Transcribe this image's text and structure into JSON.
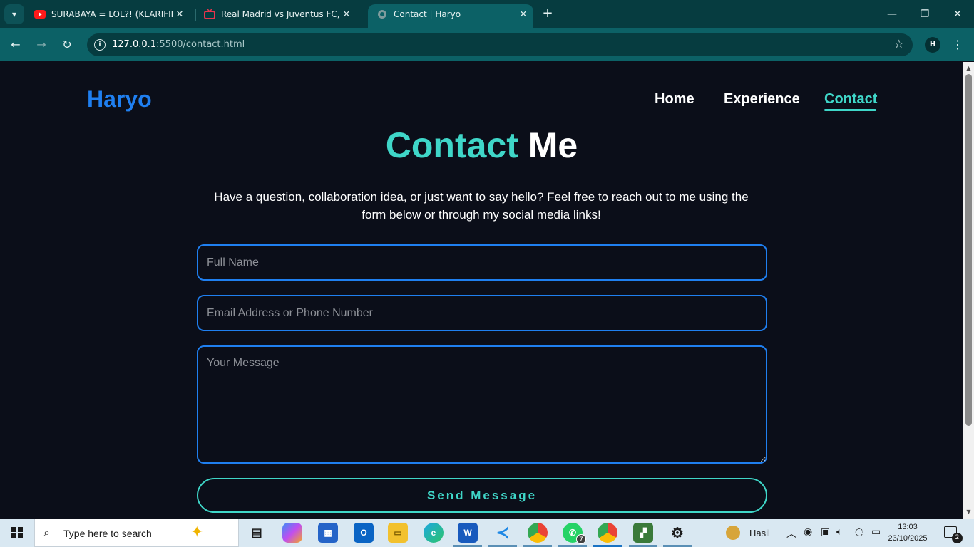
{
  "browser": {
    "tabs": [
      {
        "title": "SURABAYA = LOL?! (KLARIFIKASI",
        "icon": "youtube-icon"
      },
      {
        "title": "Real Madrid vs Juventus FC, Liga",
        "icon": "tv-icon"
      },
      {
        "title": "Contact | Haryo",
        "icon": "globe-icon"
      }
    ],
    "url_host": "127.0.0.1",
    "url_rest": ":5500/contact.html",
    "profile_initial": "H"
  },
  "site": {
    "logo": "Haryo",
    "nav": [
      "Home",
      "Experience",
      "Contact"
    ],
    "heading_accent": "Contact",
    "heading_rest": "Me",
    "intro_line1": "Have a question, collaboration idea, or just want to say hello? Feel free to reach out to me using the",
    "intro_line2": "form below or through my social media links!",
    "name_placeholder": "Full Name",
    "email_placeholder": "Email Address or Phone Number",
    "message_placeholder": "Your Message",
    "send_label": "Send Message"
  },
  "colors": {
    "background": "#0b0e19",
    "accent_teal": "#3fd6c8",
    "accent_blue": "#1f7ff0",
    "browser_frame": "#0c6166"
  },
  "taskbar": {
    "search_placeholder": "Type here to search",
    "apps": [
      "task-view",
      "copilot",
      "microsoft-store",
      "outlook",
      "file-explorer",
      "edge",
      "word",
      "vscode",
      "chrome",
      "whatsapp",
      "chrome",
      "app",
      "settings"
    ],
    "whatsapp_badge": "7",
    "weather_text": "Hasil",
    "time": "13:03",
    "date": "23/10/2025",
    "notification_count": "2"
  }
}
